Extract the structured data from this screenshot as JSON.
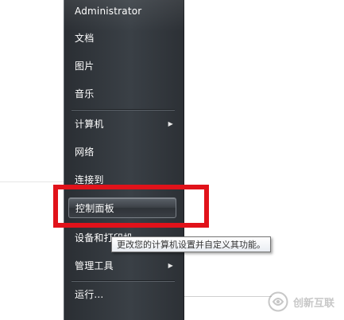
{
  "start_menu": {
    "user_name": "Administrator",
    "items": [
      {
        "label": "文档",
        "submenu": false
      },
      {
        "label": "图片",
        "submenu": false
      },
      {
        "label": "音乐",
        "submenu": false
      },
      {
        "label": "计算机",
        "submenu": true
      },
      {
        "label": "网络",
        "submenu": false
      },
      {
        "label": "连接到",
        "submenu": false
      },
      {
        "label": "控制面板",
        "submenu": false,
        "highlighted": true
      },
      {
        "label": "设备和打印机",
        "submenu": false
      },
      {
        "label": "管理工具",
        "submenu": true
      },
      {
        "label": "运行...",
        "submenu": false
      }
    ],
    "arrow_glyph": "▶"
  },
  "tooltip": {
    "text": "更改您的计算机设置并自定义其功能。"
  },
  "annotation": {
    "color": "#e1121a"
  },
  "watermark": {
    "text": "创新互联",
    "icon": "swirl-logo-icon"
  }
}
